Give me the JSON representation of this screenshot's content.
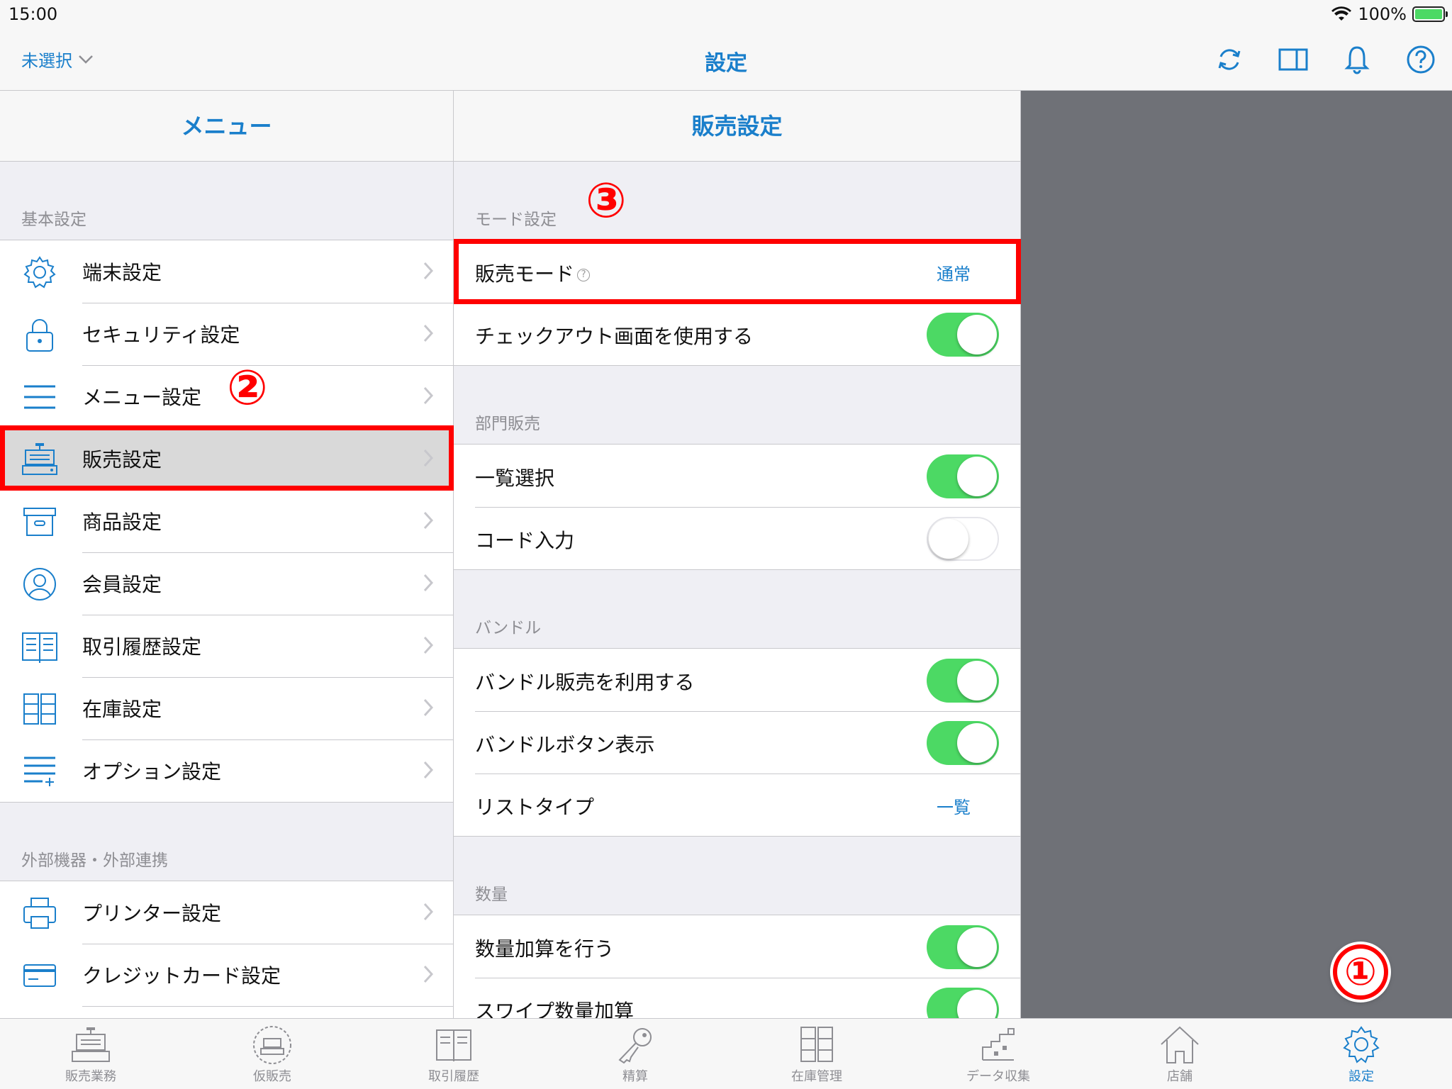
{
  "status": {
    "time": "15:00",
    "battery": "100%",
    "battery_level": 1.0
  },
  "nav": {
    "left_label": "未選択",
    "title": "設定"
  },
  "menu": {
    "title": "メニュー",
    "sections": [
      {
        "header": "基本設定",
        "items": [
          "端末設定",
          "セキュリティ設定",
          "メニュー設定",
          "販売設定",
          "商品設定",
          "会員設定",
          "取引履歴設定",
          "在庫設定",
          "オプション設定"
        ]
      },
      {
        "header": "外部機器・外部連携",
        "items": [
          "プリンター設定",
          "クレジットカード設定"
        ]
      }
    ],
    "selected": "販売設定"
  },
  "sales": {
    "title": "販売設定",
    "sections": [
      {
        "header": "モード設定",
        "rows": [
          {
            "label": "販売モード",
            "value": "通常",
            "help": "?"
          },
          {
            "label": "チェックアウト画面を使用する",
            "toggle": true
          }
        ]
      },
      {
        "header": "部門販売",
        "rows": [
          {
            "label": "一覧選択",
            "toggle": true
          },
          {
            "label": "コード入力",
            "toggle": false
          }
        ]
      },
      {
        "header": "バンドル",
        "rows": [
          {
            "label": "バンドル販売を利用する",
            "toggle": true
          },
          {
            "label": "バンドルボタン表示",
            "toggle": true
          },
          {
            "label": "リストタイプ",
            "value": "一覧"
          }
        ]
      },
      {
        "header": "数量",
        "rows": [
          {
            "label": "数量加算を行う",
            "toggle": true
          },
          {
            "label": "スワイプ数量加算",
            "toggle": true
          }
        ]
      }
    ]
  },
  "callouts": {
    "one": "①",
    "two": "②",
    "three": "③"
  },
  "tabs": [
    {
      "label": "販売業務",
      "icon": "register-icon"
    },
    {
      "label": "仮販売",
      "icon": "temp-register-icon"
    },
    {
      "label": "取引履歴",
      "icon": "book-icon"
    },
    {
      "label": "精算",
      "icon": "key-icon"
    },
    {
      "label": "在庫管理",
      "icon": "cabinet-icon"
    },
    {
      "label": "データ収集",
      "icon": "data-icon"
    },
    {
      "label": "店舗",
      "icon": "home-icon"
    },
    {
      "label": "設定",
      "icon": "gear-icon",
      "active": true
    }
  ],
  "colors": {
    "accent": "#1a7fcb",
    "toggle_on": "#4cd964",
    "highlight": "#ff0000",
    "gray_area": "#6f7177"
  }
}
